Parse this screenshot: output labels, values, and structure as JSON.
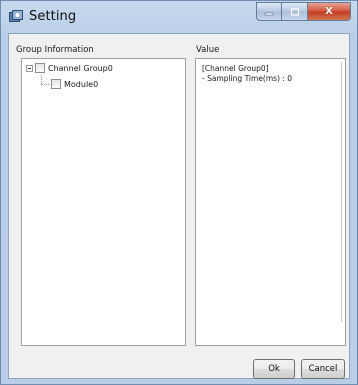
{
  "window": {
    "title": "Setting",
    "accent_color": "#b9cee6"
  },
  "caption_buttons": {
    "close_glyph": "X"
  },
  "group_panel": {
    "label": "Group Information",
    "tree": [
      {
        "label": "Channel Group0",
        "expanded": true,
        "checked": false
      },
      {
        "label": "Module0",
        "checked": false
      }
    ]
  },
  "value_panel": {
    "label": "Value",
    "lines": [
      "[Channel Group0]",
      "- Sampling Time(ms) : 0"
    ]
  },
  "footer": {
    "ok_label": "Ok",
    "cancel_label": "Cancel"
  }
}
